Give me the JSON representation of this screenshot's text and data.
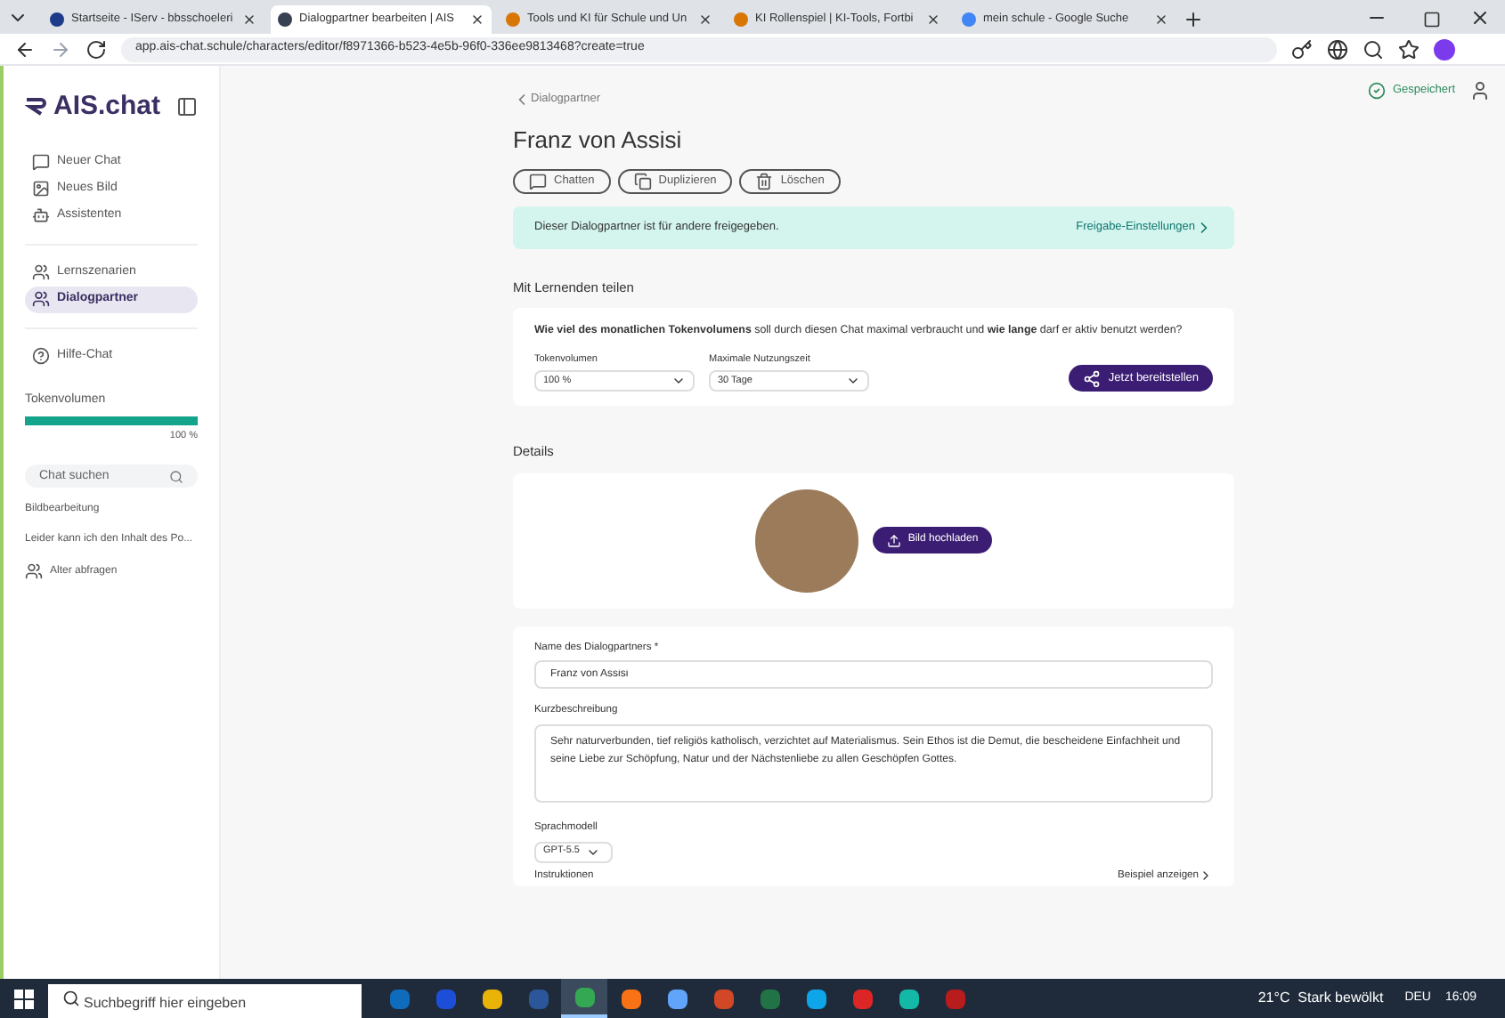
{
  "browser": {
    "tabs": [
      {
        "title": "Startseite - IServ - bbsschoeleri",
        "selected": false,
        "kind": "iserv"
      },
      {
        "title": "Dialogpartner bearbeiten | AIS",
        "selected": true,
        "kind": "ais"
      },
      {
        "title": "Tools und KI für Schule und Un",
        "selected": false,
        "kind": "tools"
      },
      {
        "title": "KI Rollenspiel | KI-Tools, Fortbi",
        "selected": false,
        "kind": "tools"
      },
      {
        "title": "mein schule - Google Suche",
        "selected": false,
        "kind": "google"
      }
    ],
    "url": "app.ais-chat.schule/characters/editor/f8971366-b523-4e5b-96f0-336ee9813468?create=true"
  },
  "sidebar": {
    "brand": "AIS.chat",
    "nav_top": [
      {
        "label": "Neuer Chat",
        "selected": false
      },
      {
        "label": "Neues Bild",
        "selected": false
      },
      {
        "label": "Assistenten",
        "selected": false
      }
    ],
    "nav_mid": [
      {
        "label": "Lernszenarien",
        "selected": false
      },
      {
        "label": "Dialogpartner",
        "selected": true
      }
    ],
    "help": "Hilfe-Chat",
    "token_label": "Tokenvolumen",
    "token": {
      "level": 1.0
    },
    "token_reading": "100 %",
    "search": {
      "placeholder": "Chat suchen"
    },
    "chats": [
      {
        "title": "Bildbearbeitung",
        "kind": "chat"
      },
      {
        "title": "Leider kann ich den Inhalt des Po...",
        "kind": "chat"
      },
      {
        "title": "Alter abfragen",
        "kind": "partner"
      }
    ]
  },
  "status": "Gespeichert",
  "main": {
    "breadcrumb": "Dialogpartner",
    "title": "Franz von Assisi",
    "actions": [
      {
        "label": "Chatten",
        "kind": "chat"
      },
      {
        "label": "Duplizieren",
        "kind": "copy"
      },
      {
        "label": "Löschen",
        "kind": "delete"
      }
    ],
    "banner": {
      "text": "Dieser Dialogpartner ist für andere freigegeben.",
      "link": "Freigabe-Einstellungen"
    },
    "share": {
      "heading": "Mit Lernenden teilen",
      "question": "**Wie viel des monatlichen Tokenvolumens** soll durch diesen Chat maximal verbraucht und **wie lange** darf er aktiv benutzt werden?",
      "fields": [
        {
          "label": "Tokenvolumen",
          "value": "100 %"
        },
        {
          "label": "Maximale Nutzungszeit",
          "value": "30 Tage"
        }
      ],
      "button": "Jetzt bereitstellen"
    },
    "details": {
      "heading": "Details",
      "upload": "Bild hochladen",
      "name_label": "Name des Dialogpartners *",
      "name_value": "Franz von Assisi",
      "desc_label": "Kurzbeschreibung",
      "desc_value": "Sehr naturverbunden, tief religiös katholisch, verzichtet auf Materialismus. Sein Ethos ist die Demut, die bescheidene Einfachheit und seine Liebe zur Schöpfung, Natur und der Nächstenliebe zu allen Geschöpfen Gottes.",
      "model_label": "Sprachmodell",
      "model_value": "GPT-5.5",
      "instr_label": "Instruktionen",
      "example_link": "Beispiel anzeigen"
    }
  },
  "taskbar": {
    "search": {
      "placeholder": "Suchbegriff hier eingeben"
    },
    "apps": [
      {
        "kind": "outlook",
        "selected": false
      },
      {
        "kind": "blue",
        "selected": false
      },
      {
        "kind": "folder",
        "selected": false
      },
      {
        "kind": "word",
        "selected": false
      },
      {
        "kind": "chrome",
        "selected": true
      },
      {
        "kind": "firefox",
        "selected": false
      },
      {
        "kind": "store",
        "selected": false
      },
      {
        "kind": "ppt",
        "selected": false
      },
      {
        "kind": "excel",
        "selected": false
      },
      {
        "kind": "edge",
        "selected": false
      },
      {
        "kind": "red",
        "selected": false
      },
      {
        "kind": "media",
        "selected": false
      },
      {
        "kind": "pdf",
        "selected": false
      }
    ],
    "weather": "21°C  Stark bewölkt",
    "lang": "DEU",
    "time": "16:09"
  }
}
